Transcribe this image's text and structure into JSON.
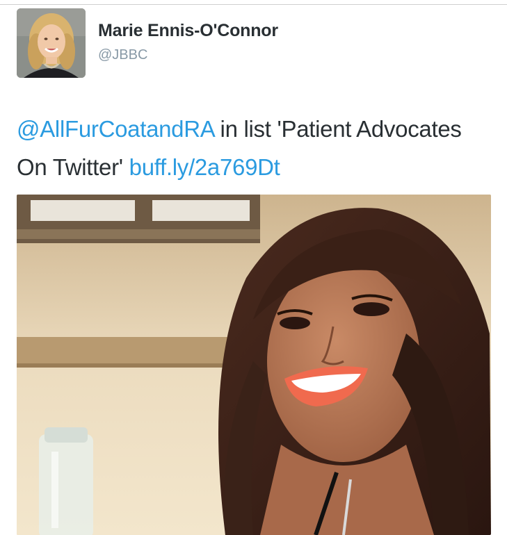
{
  "tweet": {
    "author_name": "Marie Ennis-O'Connor",
    "author_handle": "@JBBC",
    "mention": "@AllFurCoatandRA",
    "text_middle": " in list 'Patient Advocates On Twitter' ",
    "link": "buff.ly/2a769Dt"
  },
  "colors": {
    "link": "#2b9be0",
    "text": "#292f33",
    "handle": "#8899a6"
  },
  "icons": {
    "avatar": "profile-photo",
    "media": "attached-photo"
  }
}
